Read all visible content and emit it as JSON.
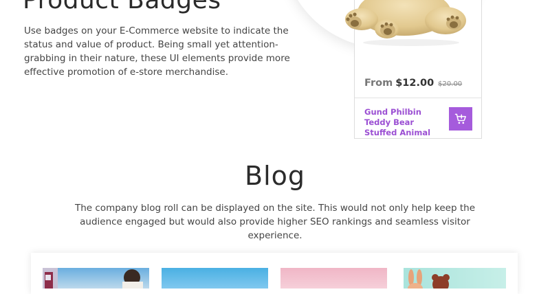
{
  "badges_section": {
    "title": "Product Badges",
    "description": "Use badges on your E-Commerce website to indicate the status and value of product. Being small yet attention-grabbing in their nature, these UI elements provide more effective promotion of e-store merchandise."
  },
  "product": {
    "price_prefix": "From",
    "price": "$12.00",
    "old_price": "$20.00",
    "name": "Gund Philbin Teddy Bear Stuffed Animal",
    "image_icon": "teddy-bear-image",
    "cart_icon": "add-to-cart-icon"
  },
  "blog_section": {
    "title": "Blog",
    "description": "The company blog roll can be displayed on the site. This would not only help keep the audience engaged but would also provide higher SEO rankings and seamless visitor experience."
  },
  "colors": {
    "accent": "#a55bdc",
    "product_name": "#9b4fd3",
    "heading": "#2b2b2b"
  }
}
